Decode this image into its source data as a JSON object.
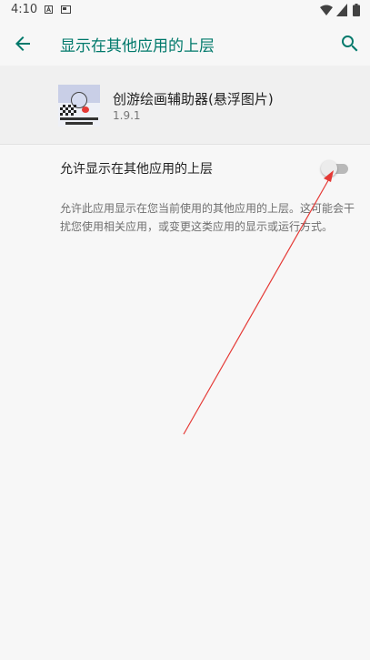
{
  "status_bar": {
    "time": "4:10",
    "icons": [
      "notification-a-icon",
      "notification-b-icon",
      "wifi-icon",
      "signal-icon",
      "battery-icon"
    ]
  },
  "toolbar": {
    "title": "显示在其他应用的上层",
    "back_icon": "arrow-back-icon",
    "search_icon": "search-icon"
  },
  "app": {
    "name": "创游绘画辅助器(悬浮图片)",
    "version": "1.9.1"
  },
  "permission": {
    "label": "允许显示在其他应用的上层",
    "enabled": false,
    "description": "允许此应用显示在您当前使用的其他应用的上层。这可能会干扰您使用相关应用，或变更这类应用的显示或运行方式。"
  },
  "colors": {
    "accent": "#00796b",
    "annotation": "#e53935",
    "background": "#f7f7f7",
    "header_background": "#f0f0f0"
  }
}
